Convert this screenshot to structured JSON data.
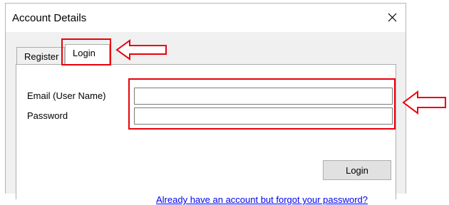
{
  "window": {
    "title": "Account Details"
  },
  "icons": {
    "close": "close-icon"
  },
  "tabs": [
    {
      "label": "Register",
      "selected": false
    },
    {
      "label": "Login",
      "selected": true
    }
  ],
  "login_form": {
    "email_label": "Email (User Name)",
    "email_value": "",
    "password_label": "Password",
    "password_value": "",
    "login_button": "Login",
    "forgot_link": "Already have an account but forgot your password?"
  },
  "annotations": {
    "highlight_color": "#e8000b"
  }
}
